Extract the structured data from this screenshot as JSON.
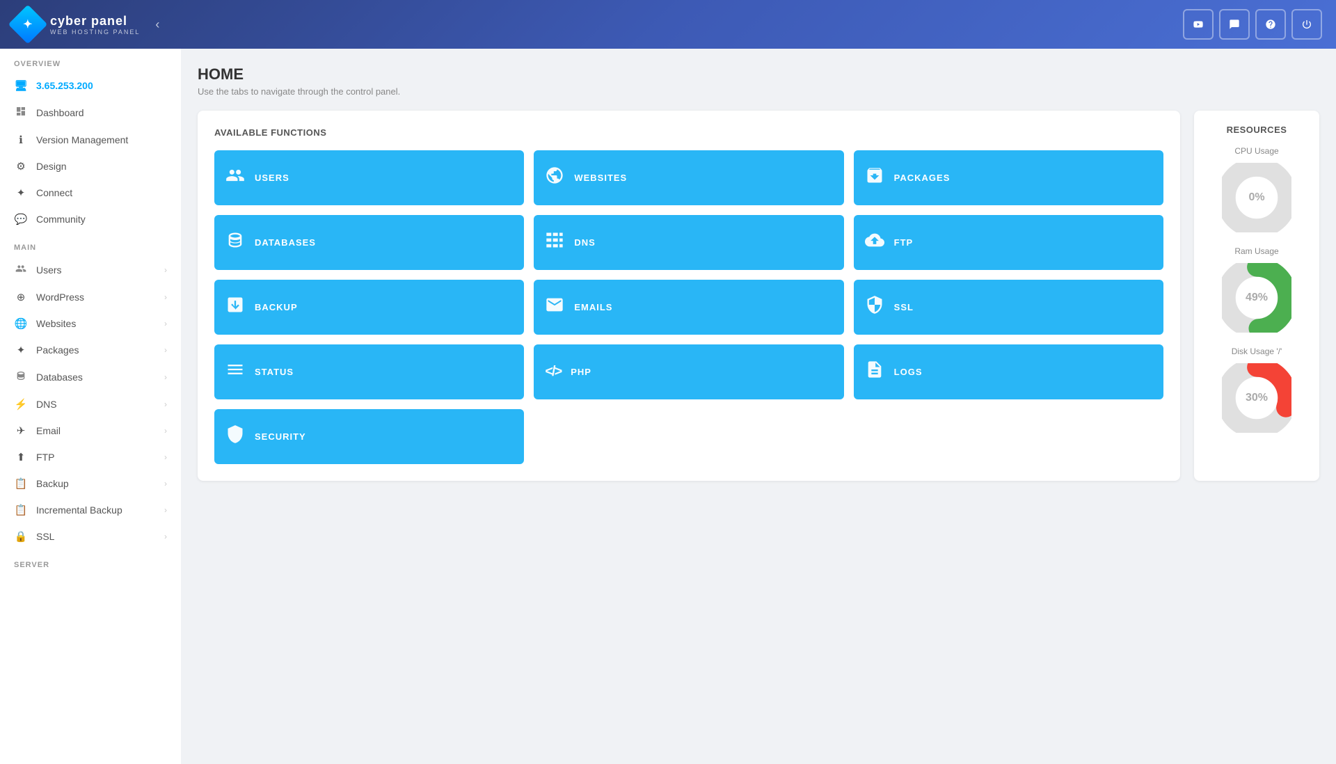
{
  "header": {
    "brand": "cyber panel",
    "sub": "WEB HOSTING PANEL",
    "collapse_btn": "‹",
    "icons": [
      "▶",
      "💬",
      "⊕",
      "⏻"
    ]
  },
  "sidebar": {
    "overview_label": "OVERVIEW",
    "ip_address": "3.65.253.200",
    "overview_items": [
      {
        "id": "dashboard",
        "label": "Dashboard",
        "icon": "🖥",
        "arrow": false
      },
      {
        "id": "version-management",
        "label": "Version Management",
        "icon": "ℹ",
        "arrow": false
      },
      {
        "id": "design",
        "label": "Design",
        "icon": "⚙",
        "arrow": false
      },
      {
        "id": "connect",
        "label": "Connect",
        "icon": "✦",
        "arrow": false
      },
      {
        "id": "community",
        "label": "Community",
        "icon": "💬",
        "arrow": false
      }
    ],
    "main_label": "MAIN",
    "main_items": [
      {
        "id": "users",
        "label": "Users",
        "icon": "👥",
        "arrow": true
      },
      {
        "id": "wordpress",
        "label": "WordPress",
        "icon": "⊕",
        "arrow": true
      },
      {
        "id": "websites",
        "label": "Websites",
        "icon": "🌐",
        "arrow": true
      },
      {
        "id": "packages",
        "label": "Packages",
        "icon": "✦",
        "arrow": true
      },
      {
        "id": "databases",
        "label": "Databases",
        "icon": "🗄",
        "arrow": true
      },
      {
        "id": "dns",
        "label": "DNS",
        "icon": "⚡",
        "arrow": true
      },
      {
        "id": "email",
        "label": "Email",
        "icon": "✈",
        "arrow": true
      },
      {
        "id": "ftp",
        "label": "FTP",
        "icon": "⬆",
        "arrow": true
      },
      {
        "id": "backup",
        "label": "Backup",
        "icon": "📋",
        "arrow": true
      },
      {
        "id": "incremental-backup",
        "label": "Incremental Backup",
        "icon": "📋",
        "arrow": true
      },
      {
        "id": "ssl",
        "label": "SSL",
        "icon": "🔒",
        "arrow": true
      }
    ],
    "server_label": "SERVER"
  },
  "page": {
    "title": "HOME",
    "subtitle": "Use the tabs to navigate through the control panel."
  },
  "functions": {
    "section_title": "AVAILABLE FUNCTIONS",
    "cards": [
      {
        "id": "users",
        "label": "USERS",
        "icon": "👥"
      },
      {
        "id": "websites",
        "label": "WEBSITES",
        "icon": "🌐"
      },
      {
        "id": "packages",
        "label": "PACKAGES",
        "icon": "📦"
      },
      {
        "id": "databases",
        "label": "DATABASES",
        "icon": "🗄"
      },
      {
        "id": "dns",
        "label": "DNS",
        "icon": "⚡"
      },
      {
        "id": "ftp",
        "label": "FTP",
        "icon": "☁"
      },
      {
        "id": "backup",
        "label": "BACKUP",
        "icon": "📋"
      },
      {
        "id": "emails",
        "label": "EMAILS",
        "icon": "✉"
      },
      {
        "id": "ssl",
        "label": "SSL",
        "icon": "🔒"
      },
      {
        "id": "status",
        "label": "STATUS",
        "icon": "☰"
      },
      {
        "id": "php",
        "label": "PHP",
        "icon": "⟨/⟩"
      },
      {
        "id": "logs",
        "label": "LOGS",
        "icon": "📄"
      },
      {
        "id": "security",
        "label": "SECURITY",
        "icon": "🛡"
      }
    ]
  },
  "resources": {
    "title": "RESOURCES",
    "cpu": {
      "label": "CPU Usage",
      "value": 0,
      "display": "0%",
      "color": "#e0e0e0",
      "stroke_color": "#e0e0e0"
    },
    "ram": {
      "label": "Ram Usage",
      "value": 49,
      "display": "49%",
      "color": "#4caf50",
      "circumference": 283
    },
    "disk": {
      "label": "Disk Usage '/'",
      "value": 30,
      "display": "30%",
      "color": "#f44336",
      "circumference": 283
    }
  }
}
